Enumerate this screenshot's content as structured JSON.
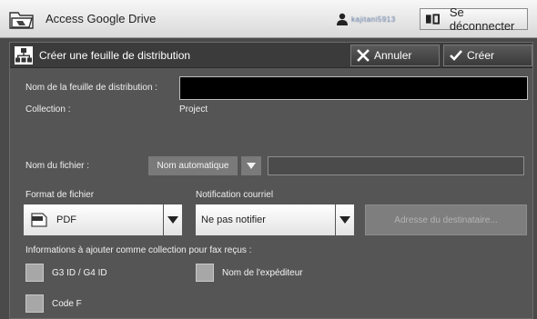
{
  "titlebar": {
    "app_title": "Access Google Drive",
    "user_name": "kajitani5913",
    "logout_label": "Se déconnecter"
  },
  "dialog": {
    "title": "Créer une feuille de distribution",
    "cancel_label": "Annuler",
    "create_label": "Créer"
  },
  "form": {
    "sheet_name_label": "Nom de la feuille de distribution :",
    "sheet_name_value": "",
    "collection_label": "Collection :",
    "collection_value": "Project",
    "file_name_label": "Nom du fichier :",
    "file_name_mode": "Nom automatique",
    "file_name_value": "",
    "file_format_label": "Format de fichier",
    "file_format_value": "PDF",
    "notification_label": "Notification courriel",
    "notification_value": "Ne pas notifier",
    "recipient_button_label": "Adresse du destinataire...",
    "fax_info_label": "Informations à ajouter comme collection pour fax reçus :",
    "checkboxes": [
      {
        "label": "G3 ID / G4 ID",
        "checked": false
      },
      {
        "label": "Nom de l'expéditeur",
        "checked": false
      },
      {
        "label": "Code F",
        "checked": false
      }
    ]
  },
  "colors": {
    "background": "#555555",
    "header": "#3b3b3b",
    "titlebar": "#e6e6e6"
  }
}
